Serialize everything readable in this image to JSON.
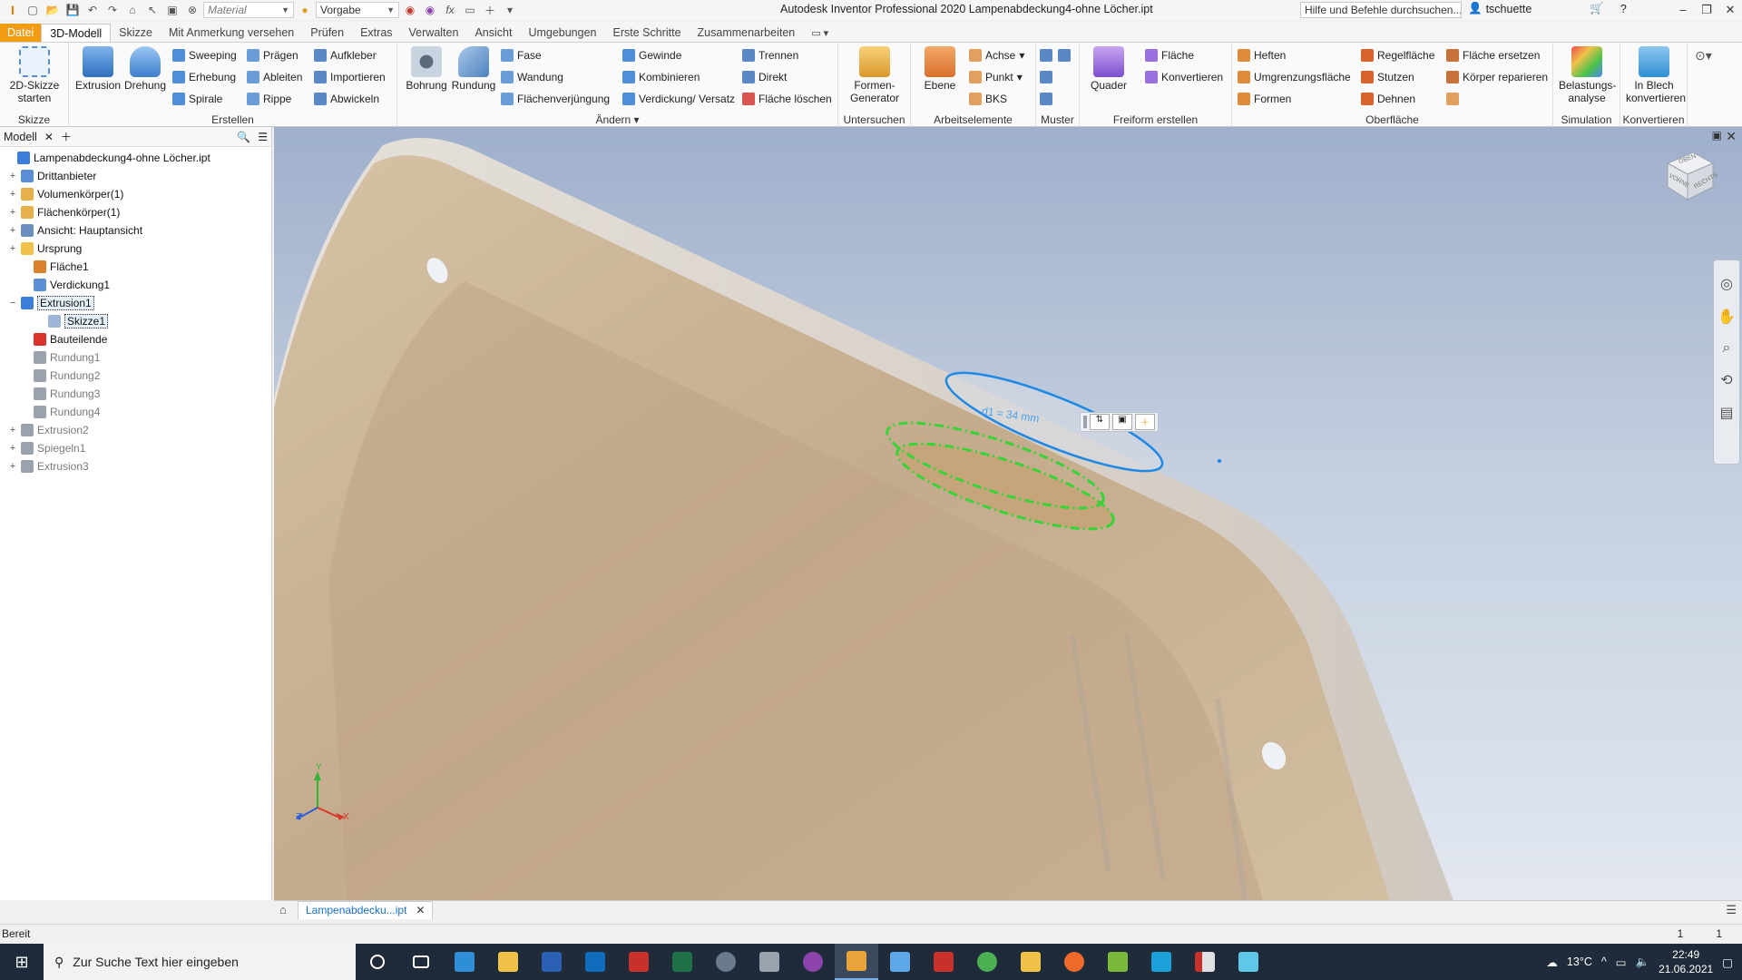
{
  "titlebar": {
    "material_placeholder": "Material",
    "appearance_value": "Vorgabe",
    "title": "Autodesk Inventor Professional 2020   Lampenabdeckung4-ohne Löcher.ipt",
    "search_text": "Hilfe und Befehle durchsuchen...",
    "user": "tschuette"
  },
  "tabs": [
    "Datei",
    "3D-Modell",
    "Skizze",
    "Mit Anmerkung versehen",
    "Prüfen",
    "Extras",
    "Verwalten",
    "Ansicht",
    "Umgebungen",
    "Erste Schritte",
    "Zusammenarbeiten"
  ],
  "ribbon": {
    "skizze": {
      "start": "2D-Skizze starten",
      "label": "Skizze"
    },
    "erstellen": {
      "label": "Erstellen",
      "extrusion": "Extrusion",
      "drehung": "Drehung",
      "sweeping": "Sweeping",
      "erhebung": "Erhebung",
      "spirale": "Spirale",
      "praegen": "Prägen",
      "ableiten": "Ableiten",
      "rippe": "Rippe",
      "aufkleber": "Aufkleber",
      "importieren": "Importieren",
      "abwickeln": "Abwickeln"
    },
    "aendern": {
      "label": "Ändern",
      "bohrung": "Bohrung",
      "rundung": "Rundung",
      "fase": "Fase",
      "wandung": "Wandung",
      "flaechenverjuengung": "Flächenverjüngung",
      "gewinde": "Gewinde",
      "kombinieren": "Kombinieren",
      "verdickung": "Verdickung/ Versatz",
      "trennen": "Trennen",
      "direkt": "Direkt",
      "flaeche_loeschen": "Fläche löschen"
    },
    "untersuchen": {
      "label": "Untersuchen",
      "formen_generator": "Formen-Generator"
    },
    "arbeitselemente": {
      "label": "Arbeitselemente",
      "ebene": "Ebene",
      "achse": "Achse",
      "punkt": "Punkt",
      "bks": "BKS"
    },
    "muster": {
      "label": "Muster"
    },
    "freiform": {
      "label": "Freiform erstellen",
      "quader": "Quader",
      "flaeche": "Fläche",
      "konvertieren": "Konvertieren"
    },
    "oberflaeche": {
      "label": "Oberfläche",
      "heften": "Heften",
      "umgrenzungsflaeche": "Umgrenzungsfläche",
      "formen": "Formen",
      "regelflaeche": "Regelfläche",
      "stutzen": "Stutzen",
      "dehnen": "Dehnen",
      "flaeche_ersetzen": "Fläche ersetzen",
      "koerper_reparieren": "Körper reparieren"
    },
    "simulation": {
      "label": "Simulation",
      "belastungsanalyse": "Belastungs-analyse"
    },
    "konvertieren": {
      "label": "Konvertieren",
      "in_blech": "In Blech konvertieren"
    }
  },
  "browser": {
    "title": "Modell",
    "items": [
      {
        "label": "Lampenabdeckung4-ohne Löcher.ipt",
        "expander": "",
        "color": "#3b7dd8",
        "dim": false
      },
      {
        "label": "Drittanbieter",
        "expander": "+",
        "color": "#5a8fd6",
        "dim": false
      },
      {
        "label": "Volumenkörper(1)",
        "expander": "+",
        "color": "#e8b04a",
        "dim": false
      },
      {
        "label": "Flächenkörper(1)",
        "expander": "+",
        "color": "#e8b04a",
        "dim": false
      },
      {
        "label": "Ansicht: Hauptansicht",
        "expander": "+",
        "color": "#6b8fbf",
        "dim": false
      },
      {
        "label": "Ursprung",
        "expander": "+",
        "color": "#f0c24a",
        "dim": false
      },
      {
        "label": "Fläche1",
        "expander": "",
        "color": "#d9822b",
        "dim": false
      },
      {
        "label": "Verdickung1",
        "expander": "",
        "color": "#5a8fd6",
        "dim": false
      },
      {
        "label": "Extrusion1",
        "expander": "−",
        "color": "#3b7dd8",
        "dim": false
      },
      {
        "label": "Skizze1",
        "expander": "",
        "color": "#9db5d6",
        "dim": false
      },
      {
        "label": "Bauteilende",
        "expander": "",
        "color": "#d9342b",
        "dim": false
      },
      {
        "label": "Rundung1",
        "expander": "",
        "color": "#9aa3ad",
        "dim": true
      },
      {
        "label": "Rundung2",
        "expander": "",
        "color": "#9aa3ad",
        "dim": true
      },
      {
        "label": "Rundung3",
        "expander": "",
        "color": "#9aa3ad",
        "dim": true
      },
      {
        "label": "Rundung4",
        "expander": "",
        "color": "#9aa3ad",
        "dim": true
      },
      {
        "label": "Extrusion2",
        "expander": "+",
        "color": "#9aa3ad",
        "dim": true
      },
      {
        "label": "Spiegeln1",
        "expander": "+",
        "color": "#9aa3ad",
        "dim": true
      },
      {
        "label": "Extrusion3",
        "expander": "+",
        "color": "#9aa3ad",
        "dim": true
      }
    ]
  },
  "viewport": {
    "dimension_label": "d1 = 34 mm",
    "viewcube_top": "OBEN",
    "viewcube_front": "VORNE",
    "viewcube_right": "RECHTS",
    "triad_x": "X",
    "triad_y": "Y",
    "triad_z": "Z"
  },
  "doc_tab": "Lampenabdecku...ipt",
  "status": {
    "text": "Bereit",
    "count1": "1",
    "count2": "1"
  },
  "taskbar": {
    "search_placeholder": "Zur Suche Text hier eingeben",
    "temperature": "13°C",
    "time": "22:49",
    "date": "21.06.2021"
  },
  "colors": {
    "accent": "#f39c12",
    "selection_blue": "#1e88e5",
    "preview_green": "#37d437",
    "part": "#c9b195"
  }
}
